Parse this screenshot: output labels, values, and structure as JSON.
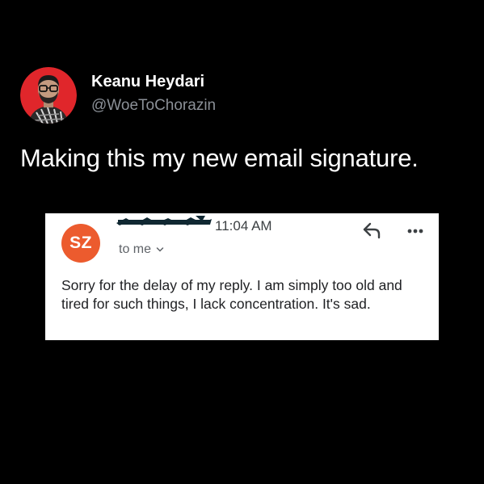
{
  "tweet": {
    "author_name": "Keanu Heydari",
    "author_handle": "@WoeToChorazin",
    "text": "Making this my new email signature.",
    "avatar_icon": "profile-photo",
    "avatar_ring_color": "#e0262b"
  },
  "email": {
    "sender_initials": "SZ",
    "sender_avatar_color": "#ec5b2e",
    "time": "11:04 AM",
    "recipient_label": "to me",
    "reply_icon": "reply-arrow-icon",
    "more_icon": "more-dots-icon",
    "body_lines": [
      "Sorry for the delay of my reply. I am simply too old and",
      "tired for such things, I lack concentration. It's sad."
    ]
  }
}
